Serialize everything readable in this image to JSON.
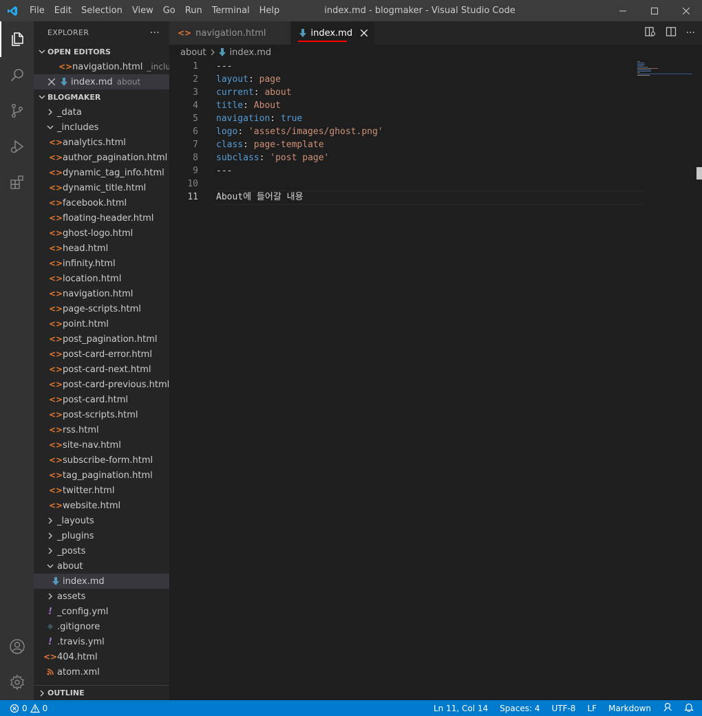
{
  "window": {
    "title": "index.md - blogmaker - Visual Studio Code"
  },
  "menu": [
    "File",
    "Edit",
    "Selection",
    "View",
    "Go",
    "Run",
    "Terminal",
    "Help"
  ],
  "sidebar": {
    "title": "EXPLORER",
    "more": "···",
    "open_editors": {
      "label": "OPEN EDITORS",
      "items": [
        {
          "name": "navigation.html",
          "desc": "_includ..."
        },
        {
          "name": "index.md",
          "desc": "about"
        }
      ]
    },
    "project": {
      "label": "BLOGMAKER",
      "data_folder": "_data",
      "includes_folder": "_includes",
      "includes_files": [
        "analytics.html",
        "author_pagination.html",
        "dynamic_tag_info.html",
        "dynamic_title.html",
        "facebook.html",
        "floating-header.html",
        "ghost-logo.html",
        "head.html",
        "infinity.html",
        "location.html",
        "navigation.html",
        "page-scripts.html",
        "point.html",
        "post_pagination.html",
        "post-card-error.html",
        "post-card-next.html",
        "post-card-previous.html",
        "post-card.html",
        "post-scripts.html",
        "rss.html",
        "site-nav.html",
        "subscribe-form.html",
        "tag_pagination.html",
        "twitter.html",
        "website.html"
      ],
      "layouts_folder": "_layouts",
      "plugins_folder": "_plugins",
      "posts_folder": "_posts",
      "about_folder": "about",
      "about_file": "index.md",
      "assets_folder": "assets",
      "config_file": "_config.yml",
      "gitignore_file": ".gitignore",
      "travis_file": ".travis.yml",
      "html404_file": "404.html",
      "atom_file": "atom.xml"
    },
    "outline_label": "OUTLINE"
  },
  "tabs": [
    {
      "label": "navigation.html"
    },
    {
      "label": "index.md"
    }
  ],
  "breadcrumb": {
    "folder": "about",
    "file": "index.md"
  },
  "code_lines": {
    "l1": {
      "num": "1",
      "text": "---"
    },
    "l2": {
      "num": "2",
      "key": "layout",
      "val": "page"
    },
    "l3": {
      "num": "3",
      "key": "current",
      "val": "about"
    },
    "l4": {
      "num": "4",
      "key": "title",
      "val": "About"
    },
    "l5": {
      "num": "5",
      "key": "navigation",
      "val": "true"
    },
    "l6": {
      "num": "6",
      "key": "logo",
      "val": "'assets/images/ghost.png'"
    },
    "l7": {
      "num": "7",
      "key": "class",
      "val": "page-template"
    },
    "l8": {
      "num": "8",
      "key": "subclass",
      "val": "'post page'"
    },
    "l9": {
      "num": "9",
      "text": "---"
    },
    "l10": {
      "num": "10",
      "text": ""
    },
    "l11": {
      "num": "11",
      "text": "About에 들어갈 내용"
    }
  },
  "status": {
    "errors": "0",
    "warnings": "0",
    "position": "Ln 11, Col 14",
    "spaces": "Spaces: 4",
    "encoding": "UTF-8",
    "eol": "LF",
    "language": "Markdown"
  },
  "colors": {
    "accent": "#007acc",
    "tab_underline": "#ff0000",
    "yaml_key": "#569cd6",
    "yaml_value": "#ce9178"
  }
}
